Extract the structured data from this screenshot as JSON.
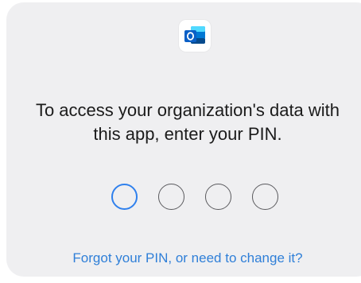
{
  "app_icon": {
    "name": "outlook-icon"
  },
  "prompt": {
    "line1": "To access your organization's data with",
    "line2": "this app, enter your PIN."
  },
  "pin": {
    "length": 4,
    "entered": 0,
    "active_index": 0,
    "active_color": "#2f80ed",
    "inactive_color": "#5a5a5e"
  },
  "forgot_link": {
    "label": "Forgot your PIN, or need to change it?"
  },
  "colors": {
    "card_background": "#efeff1",
    "link": "#2f7fd8",
    "text": "#1b1b1b"
  }
}
